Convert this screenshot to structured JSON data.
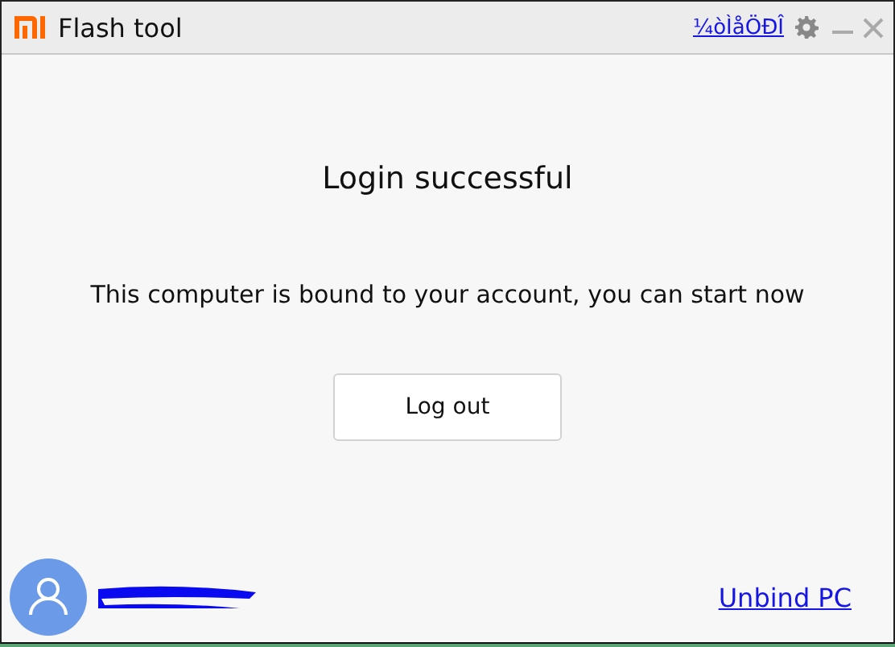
{
  "window": {
    "title": "Flash tool",
    "language_link": "¼òÌåÖÐÎ"
  },
  "content": {
    "heading": "Login successful",
    "message": "This computer is bound to your account, you can start now",
    "button": "Log out"
  },
  "footer": {
    "unbind_link": "Unbind PC"
  }
}
